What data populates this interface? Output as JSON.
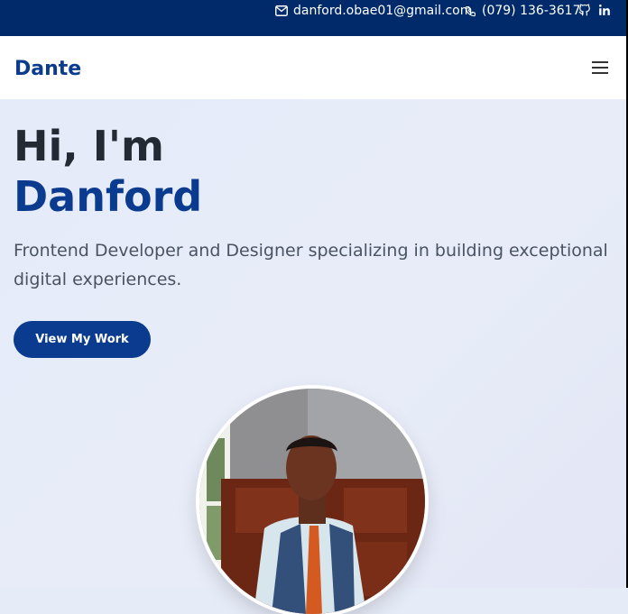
{
  "topbar": {
    "email": "danford.obae01@gmail.com",
    "phone": "(079) 136-3617",
    "icons": [
      "mail-icon",
      "phone-icon",
      "github-icon",
      "linkedin-icon"
    ]
  },
  "navbar": {
    "brand": "Dante",
    "menu_icon": "hamburger-menu-icon"
  },
  "hero": {
    "greeting": "Hi, I'm",
    "name": "Danford",
    "subtitle": "Frontend Developer and Designer specializing in building exceptional digital experiences.",
    "cta_label": "View My Work",
    "avatar_alt": "portrait"
  },
  "colors": {
    "topbar_bg": "#002a6a",
    "brand": "#0b3b8e",
    "hero_bg": "#e6ebf8",
    "heading": "#232a33"
  }
}
